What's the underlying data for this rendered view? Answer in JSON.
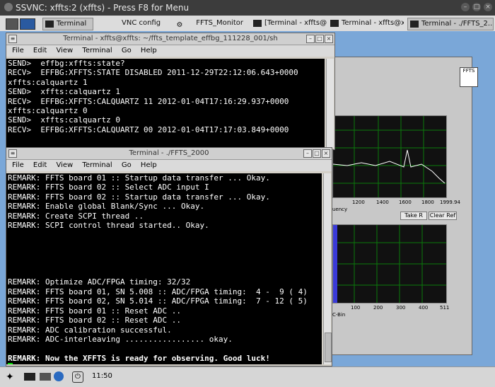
{
  "outer_window": {
    "title": "SSVNC: xffts:2 (xffts) - Press F8 for Menu"
  },
  "taskbar_top": [
    {
      "label": "Terminal",
      "active": true
    },
    {
      "label": "VNC config"
    },
    {
      "label": "FFTS_Monitor"
    },
    {
      "label": "[Terminal - xffts@x..."
    },
    {
      "label": "Terminal - xffts@x..."
    },
    {
      "label": "Terminal - ./FFTS_2..."
    }
  ],
  "term1": {
    "title": "Terminal - xffts@xffts: ~/ffts_template_effbg_111228_001/sh",
    "menu": [
      "File",
      "Edit",
      "View",
      "Terminal",
      "Go",
      "Help"
    ],
    "lines": [
      "SEND>  effbg:xffts:state?",
      "RECV>  EFFBG:XFFTS:STATE DISABLED 2011-12-29T22:12:06.643+0000",
      "xffts:calquartz 1",
      "SEND>  xffts:calquartz 1",
      "RECV>  EFFBG:XFFTS:CALQUARTZ 11 2012-01-04T17:16:29.937+0000",
      "xffts:calquartz 0",
      "SEND>  xffts:calquartz 0",
      "RECV>  EFFBG:XFFTS:CALQUARTZ 00 2012-01-04T17:17:03.849+0000"
    ]
  },
  "term2": {
    "title": "Terminal - ./FFTS_2000",
    "menu": [
      "File",
      "Edit",
      "View",
      "Terminal",
      "Go",
      "Help"
    ],
    "lines": [
      "REMARK: FFTS board 01 :: Startup data transfer ... Okay.",
      "REMARK: FFTS board 02 :: Select ADC input I",
      "REMARK: FFTS board 02 :: Startup data transfer ... Okay.",
      "REMARK: Enable global Blank/Sync ... Okay.",
      "REMARK: Create SCPI thread ..",
      "REMARK: SCPI control thread started.. Okay.",
      "",
      "",
      "",
      "",
      "",
      "REMARK: Optimize ADC/FPGA timing: 32/32",
      "REMARK: FFTS board 01, SN 5.008 :: ADC/FPGA timing:  4 -  9 ( 4)",
      "REMARK: FFTS board 02, SN 5.014 :: ADC/FPGA timing:  7 - 12 ( 5)",
      "REMARK: FFTS board 01 :: Reset ADC ..",
      "REMARK: FFTS board 02 :: Reset ADC ..",
      "REMARK: ADC calibration successful.",
      "REMARK: ADC-interleaving ................. okay.",
      "",
      "REMARK: Now the XFFTS is ready for observing. Good luck!"
    ]
  },
  "ffts_monitor": {
    "logo": "FFTS",
    "upper_ticks": [
      "1200",
      "1400",
      "1600",
      "1800",
      "1999.94"
    ],
    "upper_axis_label": "uency",
    "take_ref": "Take R",
    "clear_ref": "Clear Ref",
    "lower_ticks": [
      "100",
      "200",
      "300",
      "400",
      "511"
    ],
    "lower_axis_label": "C-Bin",
    "colors": {
      "graph_bg": "#111111",
      "grid": "#0a7a0a",
      "trace": "#ffffff",
      "bars": "#3a3ad8"
    }
  },
  "bottom_bar": {
    "clock": "11:50"
  }
}
